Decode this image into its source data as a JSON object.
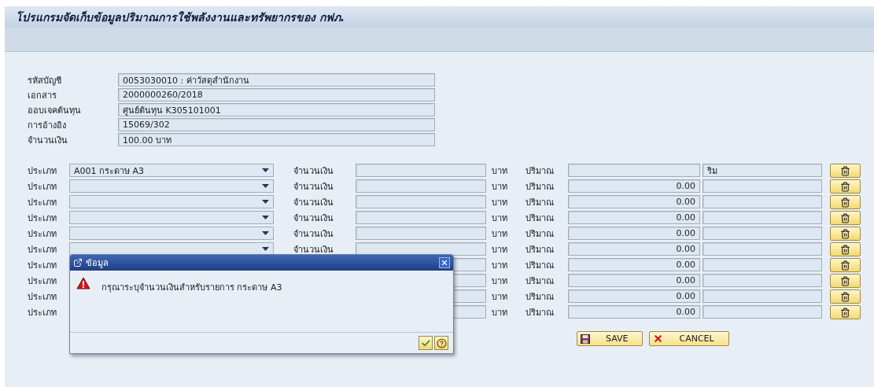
{
  "title": "โปรแกรมจัดเก็บข้อมูลปริมาณการใช้พลังงานและทรัพยากรของ กฟภ.",
  "header_fields": [
    {
      "label": "รหัสบัญชี",
      "value": "0053030010 : ค่าวัสดุสำนักงาน"
    },
    {
      "label": "เอกสาร",
      "value": "2000000260/2018"
    },
    {
      "label": "ออบเจคต้นทุน",
      "value": "ศูนย์ต้นทุน K305101001"
    },
    {
      "label": "การอ้างอิง",
      "value": "15069/302"
    },
    {
      "label": "จำนวนเงิน",
      "value": "100.00 บาท"
    }
  ],
  "items": [
    {
      "kind": "full",
      "label": "ประเภท",
      "type_value": "A001 กระดาษ A3",
      "amount_label": "จำนวนเงิน",
      "currency": "บาท",
      "quantity_label": "ปริมาณ",
      "unit": "ริม"
    },
    {
      "kind": "full",
      "label": "ประเภท",
      "amount_label": "จำนวนเงิน",
      "currency": "บาท",
      "quantity_label": "ปริมาณ",
      "quantity": "0.00"
    },
    {
      "kind": "full",
      "label": "ประเภท",
      "amount_label": "จำนวนเงิน",
      "currency": "บาท",
      "quantity_label": "ปริมาณ",
      "quantity": "0.00"
    },
    {
      "kind": "full",
      "label": "ประเภท",
      "amount_label": "จำนวนเงิน",
      "currency": "บาท",
      "quantity_label": "ปริมาณ",
      "quantity": "0.00"
    },
    {
      "kind": "full",
      "label": "ประเภท",
      "amount_label": "จำนวนเงิน",
      "currency": "บาท",
      "quantity_label": "ปริมาณ",
      "quantity": "0.00"
    },
    {
      "kind": "full",
      "label": "ประเภท",
      "amount_label": "จำนวนเงิน",
      "currency": "บาท",
      "quantity_label": "ปริมาณ",
      "quantity": "0.00"
    },
    {
      "kind": "covered",
      "label": "ประเภท",
      "currency": "บาท",
      "quantity_label": "ปริมาณ",
      "quantity": "0.00"
    },
    {
      "kind": "covered",
      "label": "ประเภท",
      "currency": "บาท",
      "quantity_label": "ปริมาณ",
      "quantity": "0.00"
    },
    {
      "kind": "covered",
      "label": "ประเภท",
      "currency": "บาท",
      "quantity_label": "ปริมาณ",
      "quantity": "0.00"
    },
    {
      "kind": "covered",
      "label": "ประเภท",
      "currency": "บาท",
      "quantity_label": "ปริมาณ",
      "quantity": "0.00"
    }
  ],
  "actions": [
    {
      "kind": "save",
      "label": "SAVE"
    },
    {
      "kind": "cancel",
      "label": "CANCEL"
    }
  ],
  "dialog": {
    "title": "ข้อมูล",
    "message": "กรุณาระบุจำนวนเงินสำหรับรายการ กระดาษ A3"
  }
}
